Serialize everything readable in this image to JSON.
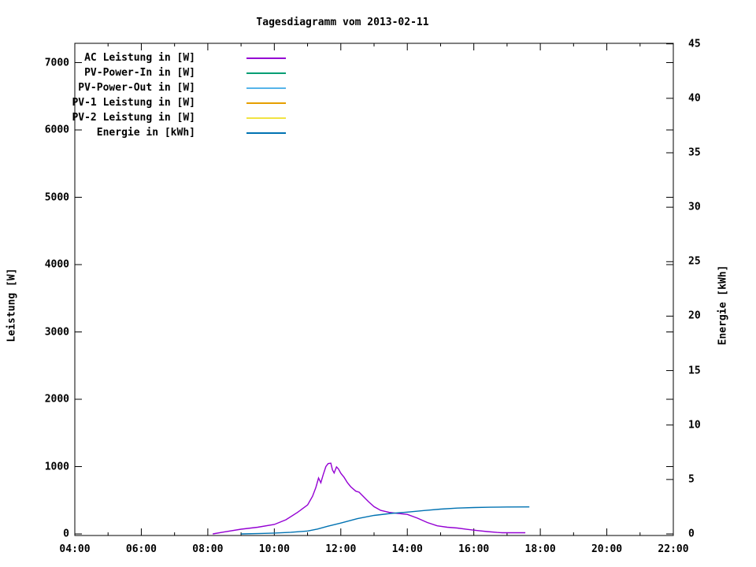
{
  "window": {
    "background": "#ffffff",
    "foreground": "#000000"
  },
  "chart_data": {
    "type": "line",
    "title": "Tagesdiagramm vom 2013-02-11",
    "grid": false,
    "legend_position": "top-left-inside",
    "x_axis": {
      "unit": "time",
      "range_hours": [
        4,
        22
      ],
      "major_tick_step_hours": 2,
      "minor_tick_step_hours": 1,
      "tick_labels": [
        "04:00",
        "06:00",
        "08:00",
        "10:00",
        "12:00",
        "14:00",
        "16:00",
        "18:00",
        "20:00",
        "22:00"
      ]
    },
    "y_left_axis": {
      "label": "Leistung [W]",
      "range": [
        0,
        7000
      ],
      "tick_step": 1000,
      "tick_labels": [
        "0",
        "1000",
        "2000",
        "3000",
        "4000",
        "5000",
        "6000",
        "7000"
      ]
    },
    "y_right_axis": {
      "label": "Energie [kWh]",
      "range": [
        0,
        45
      ],
      "tick_step": 5,
      "tick_labels": [
        "0",
        "5",
        "10",
        "15",
        "20",
        "25",
        "30",
        "35",
        "40",
        "45"
      ]
    },
    "legend": {
      "items": [
        {
          "label": "AC Leistung in [W]",
          "color": "#9400d3"
        },
        {
          "label": "PV-Power-In in [W]",
          "color": "#009e73"
        },
        {
          "label": "PV-Power-Out in [W]",
          "color": "#56b4e9"
        },
        {
          "label": "PV-1 Leistung in [W]",
          "color": "#e69f00"
        },
        {
          "label": "PV-2 Leistung in [W]",
          "color": "#f0e442"
        },
        {
          "label": "Energie in [kWh]",
          "color": "#0072b2"
        }
      ]
    },
    "series": [
      {
        "name": "AC Leistung in [W]",
        "color": "#9400d3",
        "axis": "left",
        "points": [
          [
            8.15,
            0
          ],
          [
            8.5,
            30
          ],
          [
            9.0,
            70
          ],
          [
            9.5,
            100
          ],
          [
            10.0,
            140
          ],
          [
            10.35,
            210
          ],
          [
            10.7,
            320
          ],
          [
            11.0,
            430
          ],
          [
            11.15,
            560
          ],
          [
            11.25,
            690
          ],
          [
            11.33,
            830
          ],
          [
            11.4,
            760
          ],
          [
            11.47,
            880
          ],
          [
            11.55,
            1000
          ],
          [
            11.62,
            1045
          ],
          [
            11.7,
            1050
          ],
          [
            11.75,
            950
          ],
          [
            11.8,
            905
          ],
          [
            11.87,
            995
          ],
          [
            11.93,
            965
          ],
          [
            12.0,
            900
          ],
          [
            12.1,
            840
          ],
          [
            12.2,
            760
          ],
          [
            12.3,
            700
          ],
          [
            12.45,
            635
          ],
          [
            12.55,
            620
          ],
          [
            12.7,
            545
          ],
          [
            12.85,
            470
          ],
          [
            13.0,
            405
          ],
          [
            13.2,
            350
          ],
          [
            13.45,
            320
          ],
          [
            13.7,
            305
          ],
          [
            14.0,
            290
          ],
          [
            14.3,
            235
          ],
          [
            14.6,
            170
          ],
          [
            14.9,
            120
          ],
          [
            15.2,
            100
          ],
          [
            15.5,
            88
          ],
          [
            15.8,
            68
          ],
          [
            16.1,
            50
          ],
          [
            16.4,
            35
          ],
          [
            16.7,
            22
          ],
          [
            16.85,
            18
          ],
          [
            17.55,
            18
          ]
        ]
      },
      {
        "name": "PV-Power-In in [W]",
        "color": "#009e73",
        "axis": "left",
        "points": []
      },
      {
        "name": "PV-Power-Out in [W]",
        "color": "#56b4e9",
        "axis": "left",
        "points": []
      },
      {
        "name": "PV-1 Leistung in [W]",
        "color": "#e69f00",
        "axis": "left",
        "points": []
      },
      {
        "name": "PV-2 Leistung in [W]",
        "color": "#f0e442",
        "axis": "left",
        "points": []
      },
      {
        "name": "Energie in [kWh]",
        "color": "#0072b2",
        "axis": "right",
        "points": [
          [
            9.0,
            0
          ],
          [
            9.6,
            0.04
          ],
          [
            10.0,
            0.08
          ],
          [
            10.5,
            0.15
          ],
          [
            11.0,
            0.27
          ],
          [
            11.3,
            0.45
          ],
          [
            11.6,
            0.7
          ],
          [
            12.0,
            1.0
          ],
          [
            12.5,
            1.4
          ],
          [
            13.0,
            1.7
          ],
          [
            13.5,
            1.88
          ],
          [
            14.0,
            2.0
          ],
          [
            14.5,
            2.15
          ],
          [
            15.0,
            2.28
          ],
          [
            15.5,
            2.37
          ],
          [
            16.0,
            2.42
          ],
          [
            16.5,
            2.45
          ],
          [
            17.0,
            2.47
          ],
          [
            17.67,
            2.48
          ]
        ]
      }
    ]
  }
}
